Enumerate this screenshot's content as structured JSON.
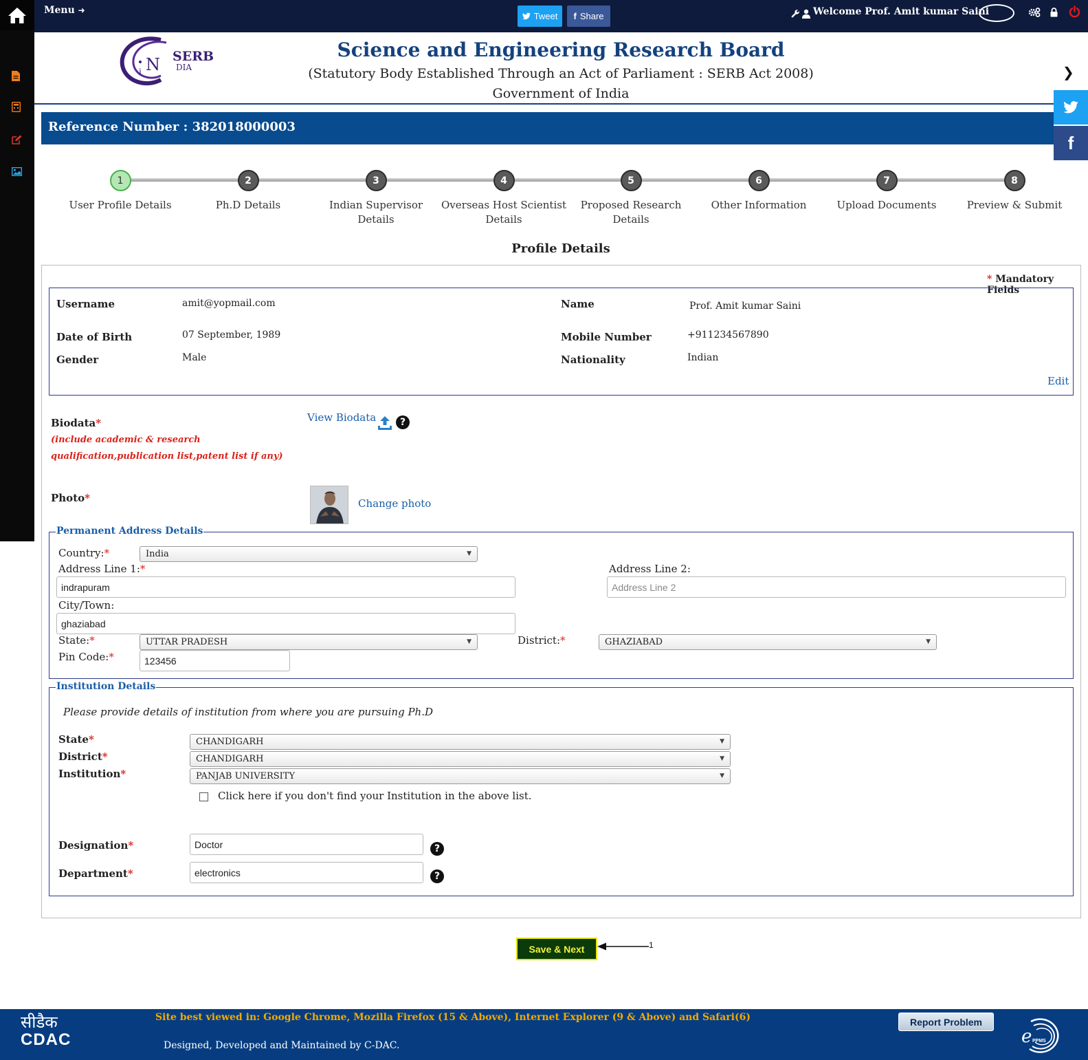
{
  "topbar": {
    "menu_label": "Menu",
    "tweet_label": "Tweet",
    "share_label": "Share",
    "welcome_text": "Welcome Prof. Amit kumar Saini"
  },
  "sidebar": {
    "icons": [
      "file-icon",
      "calculator-icon",
      "edit-icon",
      "image-icon"
    ]
  },
  "header": {
    "logo_text": "SERB",
    "logo_sub": "iN DIA",
    "title": "Science and Engineering Research Board",
    "subtitle": "(Statutory Body Established Through an Act of Parliament : SERB Act 2008)",
    "government": "Government of India"
  },
  "reference": {
    "label": "Reference Number : 382018000003"
  },
  "steps": [
    {
      "num": "1",
      "label": "User Profile Details",
      "active": true
    },
    {
      "num": "2",
      "label": "Ph.D Details"
    },
    {
      "num": "3",
      "label": "Indian Supervisor Details"
    },
    {
      "num": "4",
      "label": "Overseas Host Scientist Details"
    },
    {
      "num": "5",
      "label": "Proposed Research Details"
    },
    {
      "num": "6",
      "label": "Other Information"
    },
    {
      "num": "7",
      "label": "Upload Documents"
    },
    {
      "num": "8",
      "label": "Preview & Submit"
    }
  ],
  "profile": {
    "heading": "Profile Details",
    "mandatory_star": "*",
    "mandatory_label": "Mandatory Fields",
    "username_label": "Username",
    "username": "amit@yopmail.com",
    "name_label": "Name",
    "name": "Prof. Amit kumar Saini",
    "dob_label": "Date of Birth",
    "dob": "07 September, 1989",
    "mobile_label": "Mobile Number",
    "mobile": "+911234567890",
    "gender_label": "Gender",
    "gender": "Male",
    "nationality_label": "Nationality",
    "nationality": "Indian",
    "edit_label": "Edit"
  },
  "biodata": {
    "label": "Biodata",
    "note": "(include academic & research qualification,publication list,patent list if any)",
    "view_label": "View Biodata"
  },
  "photo": {
    "label": "Photo",
    "change_label": "Change photo"
  },
  "permanent_address": {
    "legend": "Permanent Address Details",
    "country_label": "Country:",
    "country": "India",
    "address1_label": "Address Line 1:",
    "address1": "indrapuram",
    "address2_label": "Address Line 2:",
    "address2_placeholder": "Address Line 2",
    "city_label": "City/Town:",
    "city": "ghaziabad",
    "state_label": "State:",
    "state": "UTTAR PRADESH",
    "district_label": "District:",
    "district": "GHAZIABAD",
    "pin_label": "Pin Code:",
    "pin": "123456"
  },
  "institution": {
    "legend": "Institution Details",
    "note": "Please provide details of institution from where you are pursuing Ph.D",
    "state_label": "State",
    "state": "CHANDIGARH",
    "district_label": "District",
    "district": "CHANDIGARH",
    "institution_label": "Institution",
    "institution": "PANJAB UNIVERSITY",
    "not_found_label": "Click here if you don't find your Institution in the above list.",
    "designation_label": "Designation",
    "designation": "Doctor",
    "department_label": "Department",
    "department": "electronics"
  },
  "actions": {
    "save_next_label": "Save & Next",
    "annotation": "1"
  },
  "footer": {
    "browser_note": "Site best viewed in: Google Chrome, Mozilla Firefox (15 & Above), Internet Explorer (9 & Above) and Safari(6)",
    "designed_by": "Designed, Developed and Maintained by C-DAC.",
    "report_label": "Report Problem",
    "cdac_hindi": "सीडैक",
    "cdac_text": "CDAC",
    "eppms_text": "ePPMS"
  },
  "colors": {
    "topbar": "#0e1b3c",
    "brand_blue": "#14427d",
    "reference_bar": "#084b8f",
    "required": "#d9231a",
    "link": "#1a5ea8",
    "save_button": "#0b3a0b",
    "footer": "#073d80",
    "footer_note": "#f2a900"
  }
}
